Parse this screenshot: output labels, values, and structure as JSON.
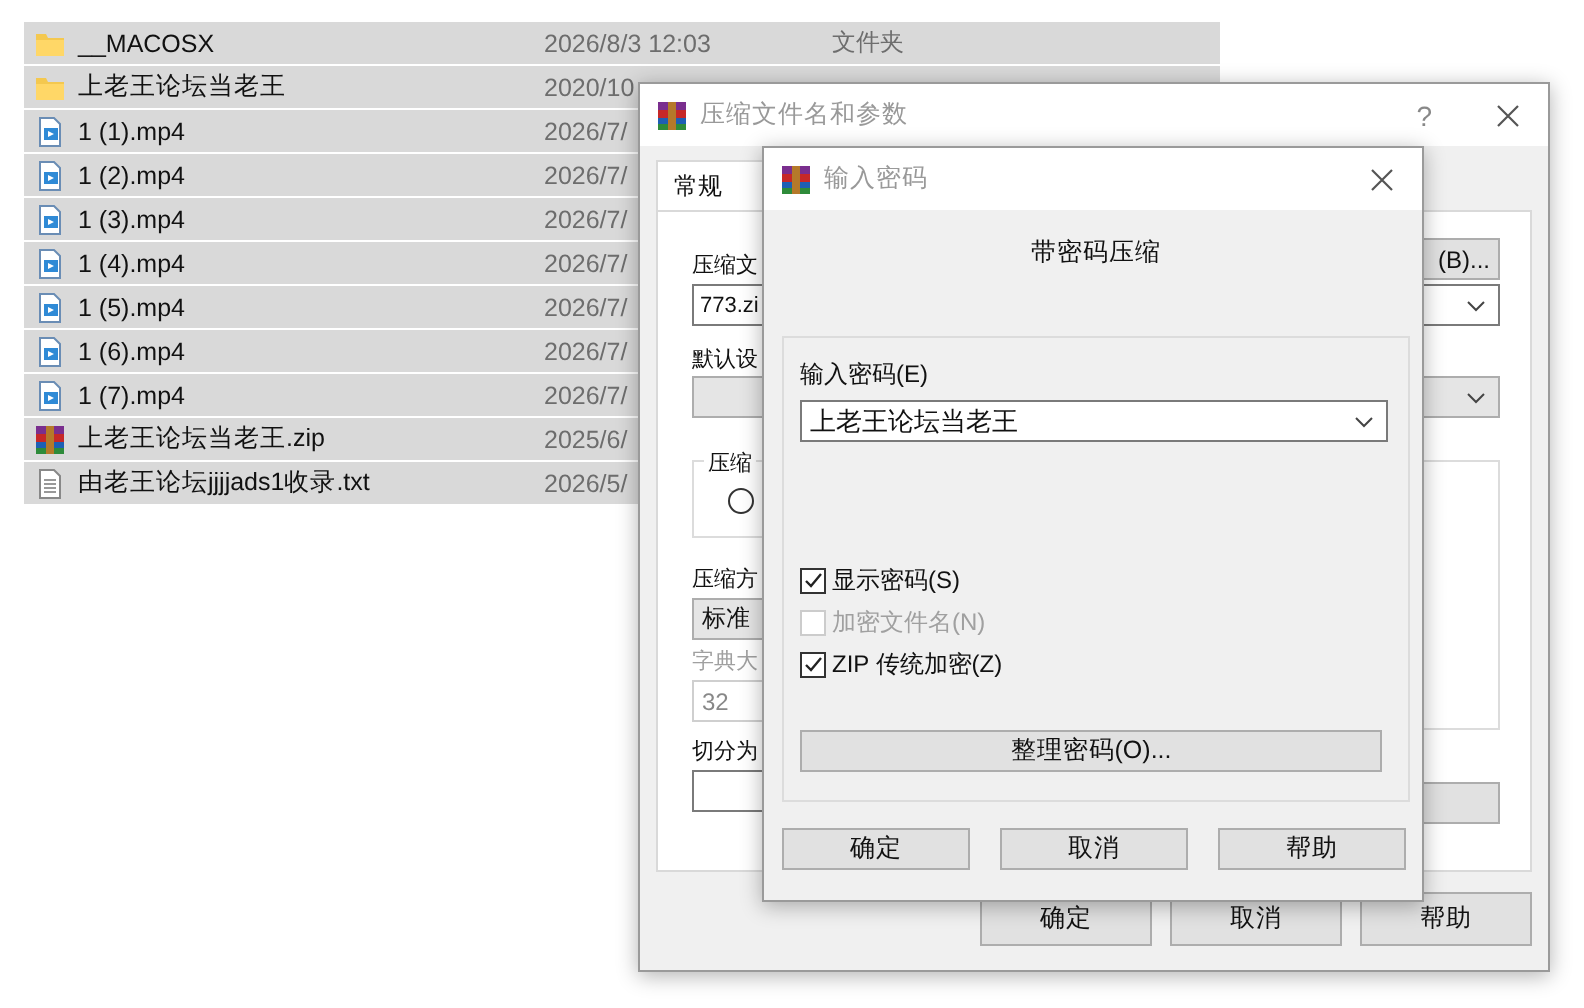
{
  "file_list": {
    "rows": [
      {
        "kind": "folder",
        "name": "__MACOSX",
        "modified": "2026/8/3 12:03",
        "type": "文件夹",
        "selected": true
      },
      {
        "kind": "folder",
        "name": "上老王论坛当老王",
        "modified": "2020/10",
        "selected": true
      },
      {
        "kind": "video",
        "name": "1 (1).mp4",
        "modified": "2026/7/",
        "selected": true
      },
      {
        "kind": "video",
        "name": "1 (2).mp4",
        "modified": "2026/7/",
        "selected": true
      },
      {
        "kind": "video",
        "name": "1 (3).mp4",
        "modified": "2026/7/",
        "selected": true
      },
      {
        "kind": "video",
        "name": "1 (4).mp4",
        "modified": "2026/7/",
        "selected": true
      },
      {
        "kind": "video",
        "name": "1 (5).mp4",
        "modified": "2026/7/",
        "selected": true
      },
      {
        "kind": "video",
        "name": "1 (6).mp4",
        "modified": "2026/7/",
        "selected": true
      },
      {
        "kind": "video",
        "name": "1 (7).mp4",
        "modified": "2026/7/",
        "selected": true
      },
      {
        "kind": "archive",
        "name": "上老王论坛当老王.zip",
        "modified": "2025/6/",
        "selected": true
      },
      {
        "kind": "text",
        "name": "由老王论坛jjjjads1收录.txt",
        "modified": "2026/5/",
        "selected": true
      }
    ]
  },
  "archive_dialog": {
    "title": "压缩文件名和参数",
    "help": "?",
    "tabs": [
      {
        "label": "常规",
        "selected": true
      }
    ],
    "archive_name_label": "压缩文",
    "browse_button": "(B)...",
    "archive_name_value": "773.zi",
    "profile_label": "默认设",
    "format_group_label": "压缩",
    "format_radio": {
      "selected": false
    },
    "method_label": "压缩方",
    "method_value": "标准",
    "dictionary_label": "字典大",
    "dictionary_value": "32",
    "dictionary_disabled": true,
    "split_label": "切分为",
    "buttons": [
      "确定",
      "取消",
      "帮助"
    ]
  },
  "password_dialog": {
    "title": "输入密码",
    "heading": "带密码压缩",
    "password_label": "输入密码(E)",
    "password_value": "上老王论坛当老王",
    "options": [
      {
        "label": "显示密码(S)",
        "checked": true,
        "disabled": false
      },
      {
        "label": "加密文件名(N)",
        "checked": false,
        "disabled": true
      },
      {
        "label": "ZIP 传统加密(Z)",
        "checked": true,
        "disabled": false
      }
    ],
    "manage_button": "整理密码(O)...",
    "buttons": [
      "确定",
      "取消",
      "帮助"
    ]
  }
}
